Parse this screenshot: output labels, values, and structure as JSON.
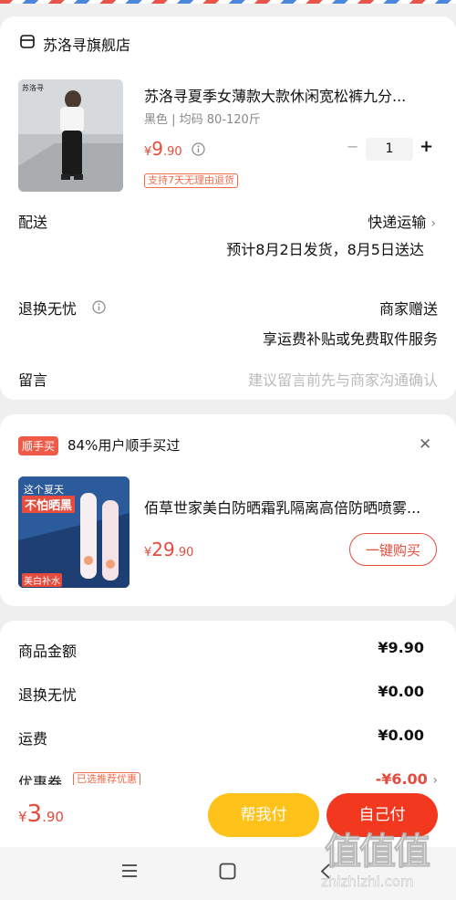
{
  "shop": {
    "name": "苏洛寻旗舰店"
  },
  "product": {
    "title": "苏洛寻夏季女薄款大款休闲宽松裤九分...",
    "spec": "黑色 | 均码 80-120斤",
    "price_int": "9",
    "price_dec": ".90",
    "currency": "¥",
    "quantity": "1",
    "minus": "−",
    "plus": "+",
    "tag": "支持7天无理由退货",
    "img_text": "苏洛寻"
  },
  "delivery": {
    "label": "配送",
    "method": "快递运输",
    "eta": "预计8月2日发货，8月5日送达"
  },
  "returns": {
    "label": "退换无忧",
    "value": "商家赠送",
    "detail": "享运费补贴或免费取件服务"
  },
  "message": {
    "label": "留言",
    "placeholder": "建议留言前先与商家沟通确认"
  },
  "recommend": {
    "badge": "顺手买",
    "headline": "84%用户顺手买过",
    "close": "✕",
    "title": "佰草世家美白防晒霜乳隔离高倍防晒喷雾...",
    "price_int": "29",
    "price_dec": ".90",
    "currency": "¥",
    "buy_label": "一键购买",
    "img_line1": "这个夏天",
    "img_line2": "不怕晒黑",
    "img_tag": "美白补水"
  },
  "summary": {
    "rows": [
      {
        "label": "商品金额",
        "value": "¥9.90"
      },
      {
        "label": "退换无忧",
        "value": "¥0.00"
      },
      {
        "label": "运费",
        "value": "¥0.00"
      }
    ],
    "coupon_label": "优惠券",
    "coupon_tag": "已选推荐优惠",
    "coupon_value": "-¥6.00"
  },
  "footer": {
    "currency": "¥",
    "total_int": "3",
    "total_dec": ".90",
    "help_pay": "帮我付",
    "self_pay": "自己付"
  },
  "watermark": {
    "text": "值值值",
    "url": "zhizhizhi.com"
  },
  "colors": {
    "accent": "#e64b3d",
    "yellow": "#ffc21a",
    "orange_red": "#f2391f"
  }
}
